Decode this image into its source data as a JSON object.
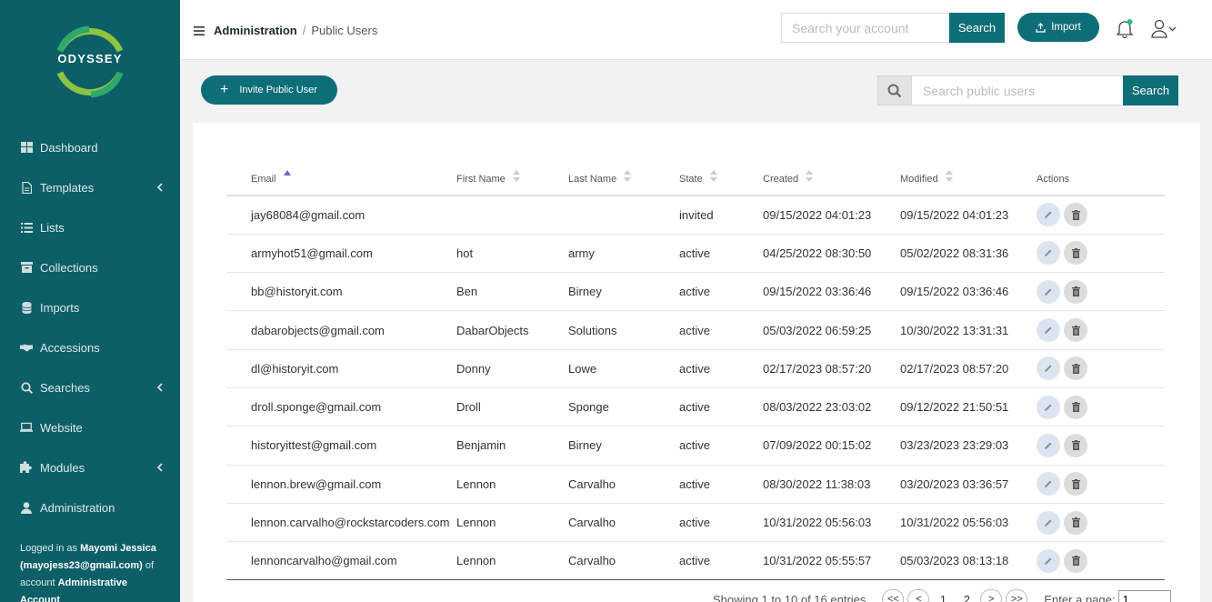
{
  "app": {
    "logo_text": "ODYSSEY"
  },
  "sidebar": {
    "items": [
      {
        "label": "Dashboard",
        "icon": "dashboard-icon",
        "has_submenu": false
      },
      {
        "label": "Templates",
        "icon": "file-icon",
        "has_submenu": true
      },
      {
        "label": "Lists",
        "icon": "list-icon",
        "has_submenu": false
      },
      {
        "label": "Collections",
        "icon": "archive-box-icon",
        "has_submenu": false
      },
      {
        "label": "Imports",
        "icon": "database-icon",
        "has_submenu": false
      },
      {
        "label": "Accessions",
        "icon": "handshake-icon",
        "has_submenu": false
      },
      {
        "label": "Searches",
        "icon": "search-icon",
        "has_submenu": true
      },
      {
        "label": "Website",
        "icon": "laptop-icon",
        "has_submenu": false
      },
      {
        "label": "Modules",
        "icon": "puzzle-icon",
        "has_submenu": true
      },
      {
        "label": "Administration",
        "icon": "user-icon",
        "has_submenu": false
      }
    ],
    "login": {
      "prefix": "Logged in as",
      "user": "Mayomi Jessica (mayojess23@gmail.com)",
      "middle": "of account",
      "account": "Administrative Account"
    }
  },
  "header": {
    "breadcrumb_root": "Administration",
    "breadcrumb_sep": "/",
    "breadcrumb_current": "Public Users",
    "account_search_placeholder": "Search your account",
    "account_search_button": "Search",
    "import_button": "Import"
  },
  "toolbar": {
    "invite_button": "Invite Public User",
    "search_placeholder": "Search public users",
    "search_button": "Search"
  },
  "table": {
    "columns": [
      "Email",
      "First Name",
      "Last Name",
      "State",
      "Created",
      "Modified",
      "Actions"
    ],
    "rows": [
      [
        "jay68084@gmail.com",
        "",
        "",
        "invited",
        "09/15/2022 04:01:23",
        "09/15/2022 04:01:23"
      ],
      [
        "armyhot51@gmail.com",
        "hot",
        "army",
        "active",
        "04/25/2022 08:30:50",
        "05/02/2022 08:31:36"
      ],
      [
        "bb@historyit.com",
        "Ben",
        "Birney",
        "active",
        "09/15/2022 03:36:46",
        "09/15/2022 03:36:46"
      ],
      [
        "dabarobjects@gmail.com",
        "DabarObjects",
        "Solutions",
        "active",
        "05/03/2022 06:59:25",
        "10/30/2022 13:31:31"
      ],
      [
        "dl@historyit.com",
        "Donny",
        "Lowe",
        "active",
        "02/17/2023 08:57:20",
        "02/17/2023 08:57:20"
      ],
      [
        "droll.sponge@gmail.com",
        "Droll",
        "Sponge",
        "active",
        "08/03/2022 23:03:02",
        "09/12/2022 21:50:51"
      ],
      [
        "historyittest@gmail.com",
        "Benjamin",
        "Birney",
        "active",
        "07/09/2022 00:15:02",
        "03/23/2023 23:29:03"
      ],
      [
        "lennon.brew@gmail.com",
        "Lennon",
        "Carvalho",
        "active",
        "08/30/2022 11:38:03",
        "03/20/2023 03:36:57"
      ],
      [
        "lennon.carvalho@rockstarcoders.com",
        "Lennon",
        "Carvalho",
        "active",
        "10/31/2022 05:56:03",
        "10/31/2022 05:56:03"
      ],
      [
        "lennoncarvalho@gmail.com",
        "Lennon",
        "Carvalho",
        "active",
        "10/31/2022 05:55:57",
        "05/03/2023 08:13:18"
      ]
    ]
  },
  "pagination": {
    "summary": "Showing 1 to 10 of 16 entries",
    "first": "<<",
    "prev": "<",
    "pages": [
      "1",
      "2"
    ],
    "next": ">",
    "last": ">>",
    "enter_label": "Enter a page:",
    "page_value": "1"
  },
  "colors": {
    "sidebar": "#0d5f67",
    "accent": "#0d6e78",
    "ring_green": "#8fc440"
  }
}
